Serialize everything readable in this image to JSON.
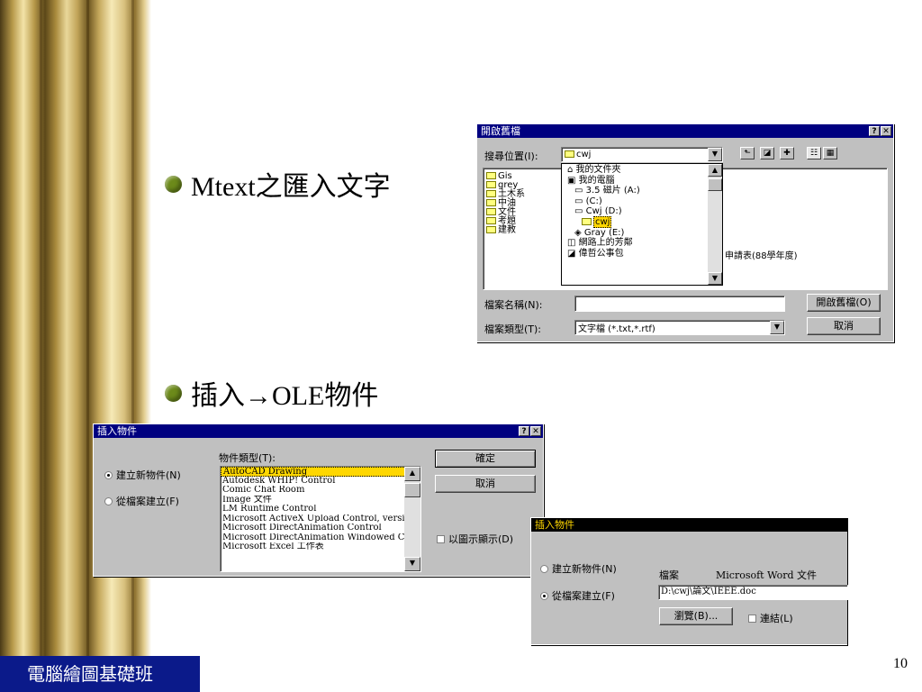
{
  "slide": {
    "bullet1": "Mtext之匯入文字",
    "bullet2": "插入→OLE物件",
    "footer": "電腦繪圖基礎班",
    "page_number": "10"
  },
  "open_dialog": {
    "title": "開啟舊檔",
    "help_btn": "?",
    "close_btn": "✕",
    "lookin_label": "搜尋位置(I):",
    "lookin_value": "cwj",
    "folders": [
      "Gis",
      "grey",
      "土木系",
      "中油",
      "文件",
      "考題",
      "建教"
    ],
    "dropdown_items": [
      "我的文件夾",
      "我的電腦",
      "3.5 磁片 (A:)",
      "(C:)",
      "Cwj (D:)",
      "cwj",
      "Gray (E:)",
      "網路上的芳鄰",
      "偉哲公事包"
    ],
    "partial_file": "申請表(88學年度)",
    "filename_label": "檔案名稱(N):",
    "filename_value": "",
    "filetype_label": "檔案類型(T):",
    "filetype_value": "文字檔 (*.txt,*.rtf)",
    "open_btn": "開啟舊檔(O)",
    "cancel_btn": "取消"
  },
  "insert_dialog_1": {
    "title": "插入物件",
    "help_btn": "?",
    "close_btn": "✕",
    "radio_new": "建立新物件(N)",
    "radio_file": "從檔案建立(F)",
    "type_label": "物件類型(T):",
    "object_types": [
      "AutoCAD Drawing",
      "Autodesk WHIP! Control",
      "Comic Chat Room",
      "Image 文件",
      "LM Runtime Control",
      "Microsoft ActiveX Upload Control, versi",
      "Microsoft DirectAnimation Control",
      "Microsoft DirectAnimation Windowed Co",
      "Microsoft Excel 工作表"
    ],
    "ok_btn": "確定",
    "cancel_btn": "取消",
    "display_icon": "以圖示顯示(D)"
  },
  "insert_dialog_2": {
    "title": "插入物件",
    "radio_new": "建立新物件(N)",
    "radio_file": "從檔案建立(F)",
    "file_label": "檔案",
    "file_type": "Microsoft Word 文件",
    "file_path": "D:\\cwj\\論文\\IEEE.doc",
    "browse_btn": "瀏覽(B)...",
    "link_label": "連結(L)"
  },
  "colors": {
    "titlebar": "#000080",
    "dialog_face": "#c0c0c0",
    "footer_bg": "#0b1a8a",
    "bullet": "#6c8a1a",
    "selection": "#ffd700"
  }
}
